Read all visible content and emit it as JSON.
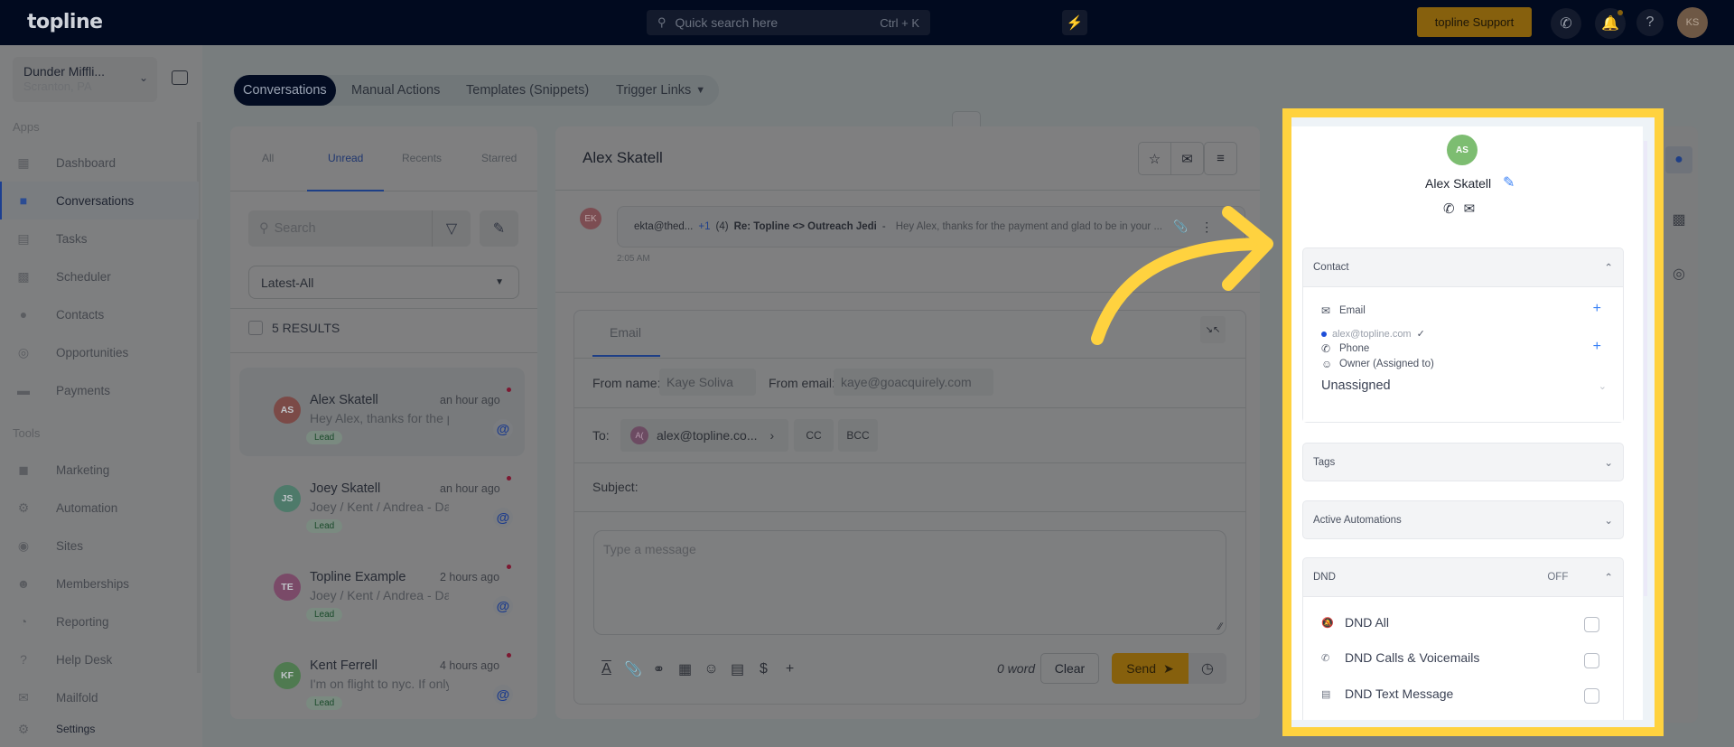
{
  "topbar": {
    "logo": "topline",
    "search_placeholder": "Quick search here",
    "search_shortcut": "Ctrl + K",
    "support_label": "topline Support",
    "user_initials": "KS",
    "accent_color": "#ffb70d"
  },
  "sidebar": {
    "location_name": "Dunder Miffli...",
    "location_city": "Scranton, PA",
    "groups": {
      "apps": "Apps",
      "tools": "Tools"
    },
    "apps": [
      {
        "label": "Dashboard",
        "icon": "dashboard-icon"
      },
      {
        "label": "Conversations",
        "icon": "chat-icon",
        "active": true
      },
      {
        "label": "Tasks",
        "icon": "task-icon"
      },
      {
        "label": "Scheduler",
        "icon": "calendar-icon"
      },
      {
        "label": "Contacts",
        "icon": "person-icon"
      },
      {
        "label": "Opportunities",
        "icon": "target-icon"
      },
      {
        "label": "Payments",
        "icon": "card-icon"
      }
    ],
    "tools": [
      {
        "label": "Marketing",
        "icon": "megaphone-icon"
      },
      {
        "label": "Automation",
        "icon": "gears-icon"
      },
      {
        "label": "Sites",
        "icon": "globe-icon"
      },
      {
        "label": "Memberships",
        "icon": "users-icon"
      },
      {
        "label": "Reporting",
        "icon": "pie-icon"
      },
      {
        "label": "Help Desk",
        "icon": "help-icon"
      },
      {
        "label": "Mailfold",
        "icon": "mail-icon"
      }
    ],
    "settings": "Settings"
  },
  "top_tabs": [
    {
      "label": "Conversations",
      "active": true
    },
    {
      "label": "Manual Actions"
    },
    {
      "label": "Templates (Snippets)"
    },
    {
      "label": "Trigger Links"
    }
  ],
  "conv_list": {
    "tabs": [
      "All",
      "Unread",
      "Recents",
      "Starred"
    ],
    "active_tab": "Unread",
    "search_placeholder": "Search",
    "sort_value": "Latest-All",
    "results_label": "5 RESULTS",
    "items": [
      {
        "initials": "AS",
        "name": "Alex Skatell",
        "time": "an hour ago",
        "preview": "Hey Alex, thanks for the payment",
        "tag": "Lead",
        "color": "#7b4a47"
      },
      {
        "initials": "JS",
        "name": "Joey Skatell",
        "time": "an hour ago",
        "preview": "Joey / Kent / Andrea - Daily",
        "tag": "Lead",
        "color": "#4e7a6a"
      },
      {
        "initials": "TE",
        "name": "Topline Example",
        "time": "2 hours ago",
        "preview": "Joey / Kent / Andrea - Daily",
        "tag": "Lead",
        "color": "#7a4a68"
      },
      {
        "initials": "KF",
        "name": "Kent Ferrell",
        "time": "4 hours ago",
        "preview": "I'm on flight to nyc.  If only",
        "tag": "Lead",
        "color": "#4f7a50"
      }
    ]
  },
  "thread": {
    "title": "Alex Skatell",
    "message": {
      "avatar": "EK",
      "from": "ekta@thed...",
      "extra": "+1",
      "count": "(4)",
      "subject": "Re: Topline <> Outreach Jedi",
      "separator": "-",
      "preview": "Hey Alex, thanks for the payment and glad to be in your ...",
      "time": "2:05 AM"
    }
  },
  "composer": {
    "tab": "Email",
    "from_name_label": "From name:",
    "from_name_value": "Kaye Soliva",
    "from_email_label": "From email:",
    "from_email_value": "kaye@goacquirely.com",
    "to_label": "To:",
    "to_avatar": "A(",
    "to_value": "alex@topline.co...",
    "cc": "CC",
    "bcc": "BCC",
    "subject_label": "Subject:",
    "message_placeholder": "Type a message",
    "word_count": "0 word",
    "clear_label": "Clear",
    "send_label": "Send"
  },
  "contact_panel": {
    "initials": "AS",
    "name": "Alex Skatell",
    "sections": {
      "contact": "Contact",
      "tags": "Tags",
      "automations": "Active Automations",
      "dnd": "DND",
      "dnd_status": "OFF"
    },
    "email_label": "Email",
    "email_value": "alex@topline.com",
    "phone_label": "Phone",
    "owner_label": "Owner (Assigned to)",
    "owner_value": "Unassigned",
    "dnd_items": [
      {
        "label": "DND All",
        "checked": false
      },
      {
        "label": "DND Calls & Voicemails",
        "checked": false
      },
      {
        "label": "DND Text Message",
        "checked": false
      }
    ],
    "highlight_color": "#ffd23f"
  }
}
